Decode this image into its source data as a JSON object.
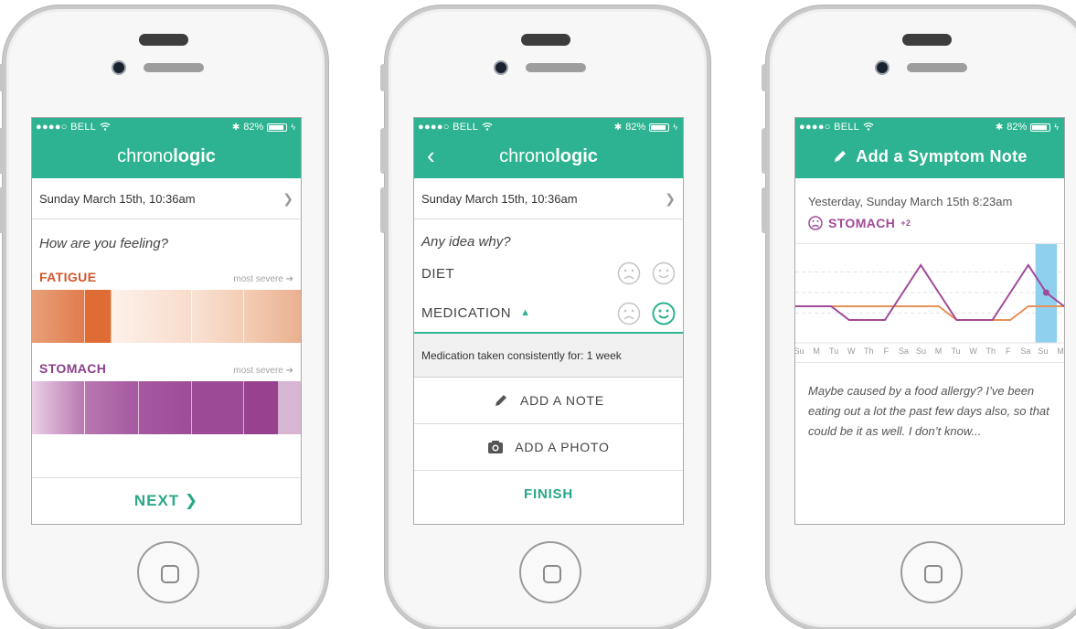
{
  "status": {
    "carrier": "●●●●○ BELL",
    "battery": "82%"
  },
  "screen1": {
    "brand_light": "chrono",
    "brand_bold": "logic",
    "date": "Sunday March 15th, 10:36am",
    "question": "How are you feeling?",
    "symptoms": [
      {
        "name": "FATIGUE",
        "hint": "most severe ➔",
        "color": "#d4562b"
      },
      {
        "name": "STOMACH",
        "hint": "most severe ➔",
        "color": "#8a3f8c"
      }
    ],
    "next_label": "NEXT  ❯"
  },
  "screen2": {
    "brand_light": "chrono",
    "brand_bold": "logic",
    "date": "Sunday March 15th, 10:36am",
    "question": "Any idea why?",
    "causes": [
      {
        "label": "DIET",
        "selected": "none"
      },
      {
        "label": "MEDICATION",
        "selected": "happy"
      }
    ],
    "info": "Medication taken consistently for: 1 week",
    "add_note": "ADD A NOTE",
    "add_photo": "ADD A PHOTO",
    "finish": "FINISH"
  },
  "screen3": {
    "title": "Add a Symptom Note",
    "date": "Yesterday, Sunday March 15th  8:23am",
    "symptom": "STOMACH",
    "symptom_extra": "+2",
    "note": "Maybe caused by a food allergy? I’ve been eating out a lot the past few days also, so that could be it as well. I don’t know...",
    "chart_data": {
      "type": "line",
      "categories": [
        "Su",
        "M",
        "Tu",
        "W",
        "Th",
        "F",
        "Sa",
        "Su",
        "M",
        "Tu",
        "W",
        "Th",
        "F",
        "Sa",
        "Su",
        "M"
      ],
      "series": [
        {
          "values": [
            2,
            2,
            2,
            2,
            2,
            2,
            2,
            2,
            2,
            1,
            1,
            1,
            1,
            2,
            2,
            2
          ],
          "color": "#e8915a"
        },
        {
          "values": [
            2,
            2,
            2,
            1,
            1,
            1,
            3,
            5,
            3,
            1,
            1,
            1,
            3,
            5,
            3,
            2
          ],
          "color": "#a04a9a"
        }
      ],
      "highlight_index": 14,
      "highlight_color": "#8fd0ef",
      "ylim": [
        0,
        6
      ]
    }
  },
  "colors": {
    "accent": "#2db391",
    "purple": "#a04a9a"
  }
}
